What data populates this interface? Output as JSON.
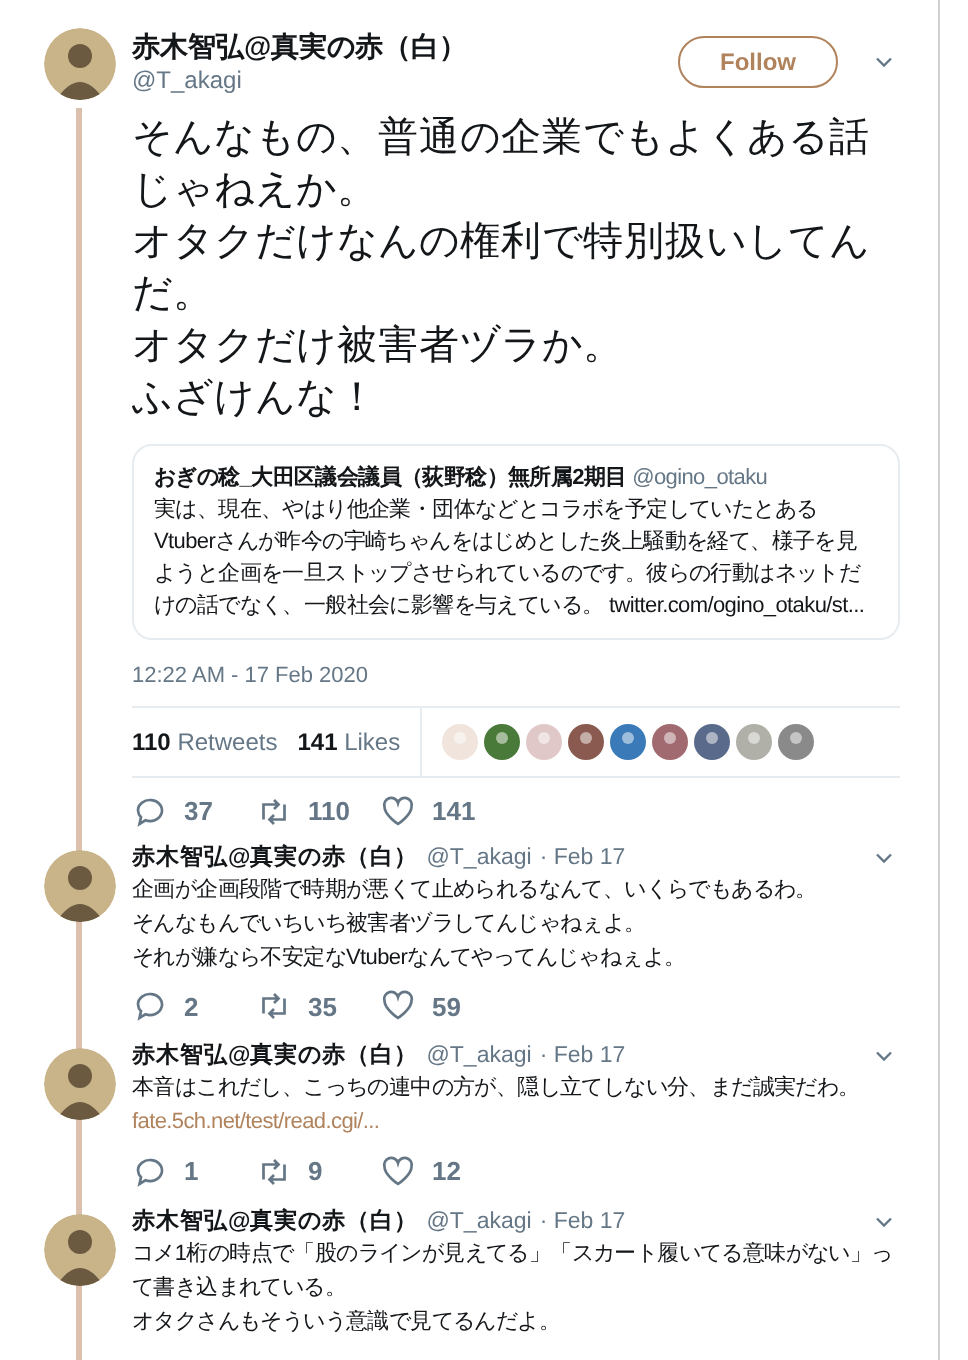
{
  "main_tweet": {
    "display_name": "赤木智弘@真実の赤（白）",
    "handle": "@T_akagi",
    "follow_button": "Follow",
    "paragraphs": [
      "そんなもの、普通の企業でもよくある話じゃねえか。",
      "オタクだけなんの権利で特別扱いしてんだ。",
      "オタクだけ被害者ヅラか。",
      "ふざけんな！"
    ],
    "quoted_tweet": {
      "display_name": "おぎの稔_大田区議会議員（荻野稔）無所属2期目",
      "handle": "@ogino_otaku",
      "text": "実は、現在、やはり他企業・団体などとコラボを予定していたとあるVtuberさんが昨今の宇崎ちゃんをはじめとした炎上騒動を経て、様子を見ようと企画を一旦ストップさせられているのです。彼らの行動はネットだけの話でなく、一般社会に影響を与えている。",
      "link": "twitter.com/ogino_otaku/st..."
    },
    "timestamp": "12:22 AM - 17 Feb 2020",
    "stats": {
      "retweets_count": "110",
      "retweets_label": "Retweets",
      "likes_count": "141",
      "likes_label": "Likes"
    },
    "actions": {
      "replies": "37",
      "retweets": "110",
      "likes": "141"
    }
  },
  "replies": [
    {
      "display_name": "赤木智弘@真実の赤（白）",
      "handle": "@T_akagi",
      "date": "· Feb 17",
      "paragraphs": [
        "企画が企画段階で時期が悪くて止められるなんて、いくらでもあるわ。",
        "そんなもんでいちいち被害者ヅラしてんじゃねぇよ。",
        "それが嫌なら不安定なVtuberなんてやってんじゃねぇよ。"
      ],
      "actions": {
        "replies": "2",
        "retweets": "35",
        "likes": "59"
      }
    },
    {
      "display_name": "赤木智弘@真実の赤（白）",
      "handle": "@T_akagi",
      "date": "· Feb 17",
      "paragraphs": [
        "本音はこれだし、こっちの連中の方が、隠し立てしない分、まだ誠実だわ。"
      ],
      "link": "fate.5ch.net/test/read.cgi/...",
      "actions": {
        "replies": "1",
        "retweets": "9",
        "likes": "12"
      }
    },
    {
      "display_name": "赤木智弘@真実の赤（白）",
      "handle": "@T_akagi",
      "date": "· Feb 17",
      "paragraphs": [
        "コメ1桁の時点で「股のラインが見えてる」「スカート履いてる意味がない」って書き込まれている。",
        "オタクさんもそういう意識で見てるんだよ。"
      ]
    }
  ]
}
